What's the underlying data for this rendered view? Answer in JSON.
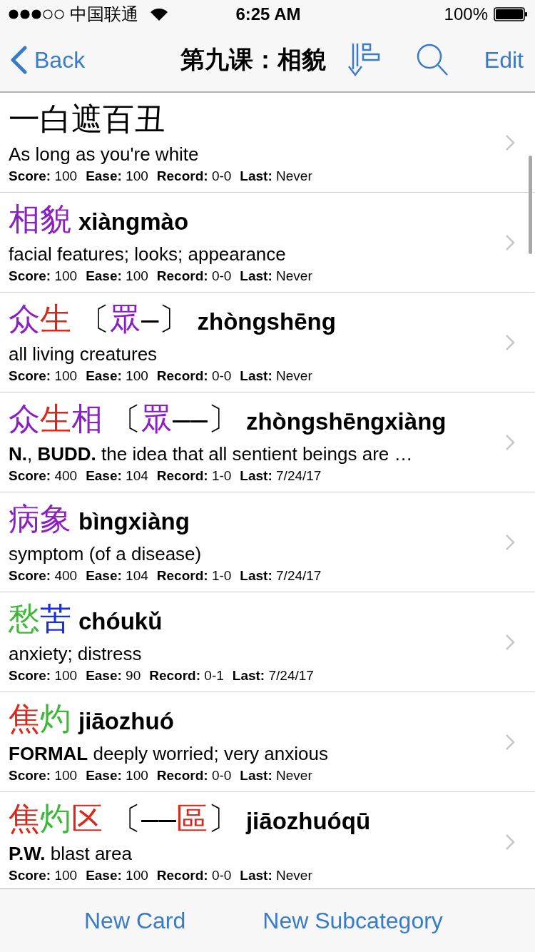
{
  "status_bar": {
    "carrier": "中国联通",
    "time": "6:25 AM",
    "battery": "100%"
  },
  "nav": {
    "back": "Back",
    "title": "第九课：相貌",
    "edit": "Edit"
  },
  "cards": [
    {
      "headword": [
        {
          "text": "一白遮百丑",
          "color": "#000000"
        }
      ],
      "definition": "As long as you're white",
      "stats": [
        {
          "label": "Score:",
          "value": "100"
        },
        {
          "label": "Ease:",
          "value": "100"
        },
        {
          "label": "Record:",
          "value": "0-0"
        },
        {
          "label": "Last:",
          "value": "Never"
        }
      ]
    },
    {
      "headword": [
        {
          "text": "相貌",
          "color": "#8a1fc4"
        }
      ],
      "pinyin": "xiàngmào",
      "definition": "facial features; looks; appearance",
      "stats": [
        {
          "label": "Score:",
          "value": "100"
        },
        {
          "label": "Ease:",
          "value": "100"
        },
        {
          "label": "Record:",
          "value": "0-0"
        },
        {
          "label": "Last:",
          "value": "Never"
        }
      ]
    },
    {
      "headword": [
        {
          "text": "众",
          "color": "#8a1fc4"
        },
        {
          "text": "生",
          "color": "#d8291c"
        }
      ],
      "traditional": [
        {
          "text": "〔",
          "color": "#000000"
        },
        {
          "text": "眾",
          "color": "#8a1fc4"
        },
        {
          "text": "–〕",
          "color": "#000000"
        }
      ],
      "pinyin": "zhòngshēng",
      "definition": "all living creatures",
      "stats": [
        {
          "label": "Score:",
          "value": "100"
        },
        {
          "label": "Ease:",
          "value": "100"
        },
        {
          "label": "Record:",
          "value": "0-0"
        },
        {
          "label": "Last:",
          "value": "Never"
        }
      ]
    },
    {
      "headword": [
        {
          "text": "众",
          "color": "#8a1fc4"
        },
        {
          "text": "生",
          "color": "#d8291c"
        },
        {
          "text": "相",
          "color": "#8a1fc4"
        }
      ],
      "traditional": [
        {
          "text": "〔",
          "color": "#000000"
        },
        {
          "text": "眾",
          "color": "#8a1fc4"
        },
        {
          "text": "––〕",
          "color": "#000000"
        }
      ],
      "pinyin": "zhòngshēngxiàng",
      "definition": "**N.**, **BUDD.** the idea that all sentient beings are …",
      "stats": [
        {
          "label": "Score:",
          "value": "400"
        },
        {
          "label": "Ease:",
          "value": "104"
        },
        {
          "label": "Record:",
          "value": "1-0"
        },
        {
          "label": "Last:",
          "value": "7/24/17"
        }
      ]
    },
    {
      "headword": [
        {
          "text": "病象",
          "color": "#8a1fc4"
        }
      ],
      "pinyin": "bìngxiàng",
      "definition": "symptom (of a disease)",
      "stats": [
        {
          "label": "Score:",
          "value": "400"
        },
        {
          "label": "Ease:",
          "value": "104"
        },
        {
          "label": "Record:",
          "value": "1-0"
        },
        {
          "label": "Last:",
          "value": "7/24/17"
        }
      ]
    },
    {
      "headword": [
        {
          "text": "愁",
          "color": "#3fb83a"
        },
        {
          "text": "苦",
          "color": "#1a2fe0"
        }
      ],
      "pinyin": "chóukǔ",
      "definition": "anxiety; distress",
      "stats": [
        {
          "label": "Score:",
          "value": "100"
        },
        {
          "label": "Ease:",
          "value": "90"
        },
        {
          "label": "Record:",
          "value": "0-1"
        },
        {
          "label": "Last:",
          "value": "7/24/17"
        }
      ]
    },
    {
      "headword": [
        {
          "text": "焦",
          "color": "#d8291c"
        },
        {
          "text": "灼",
          "color": "#3fb83a"
        }
      ],
      "pinyin": "jiāozhuó",
      "definition": "**FORMAL** deeply worried; very anxious",
      "stats": [
        {
          "label": "Score:",
          "value": "100"
        },
        {
          "label": "Ease:",
          "value": "100"
        },
        {
          "label": "Record:",
          "value": "0-0"
        },
        {
          "label": "Last:",
          "value": "Never"
        }
      ]
    },
    {
      "headword": [
        {
          "text": "焦",
          "color": "#d8291c"
        },
        {
          "text": "灼",
          "color": "#3fb83a"
        },
        {
          "text": "区",
          "color": "#d8291c"
        }
      ],
      "traditional": [
        {
          "text": "〔––",
          "color": "#000000"
        },
        {
          "text": "區",
          "color": "#d8291c"
        },
        {
          "text": "〕",
          "color": "#000000"
        }
      ],
      "pinyin": "jiāozhuóqū",
      "definition": "**P.W.** blast area",
      "stats": [
        {
          "label": "Score:",
          "value": "100"
        },
        {
          "label": "Ease:",
          "value": "100"
        },
        {
          "label": "Record:",
          "value": "0-0"
        },
        {
          "label": "Last:",
          "value": "Never"
        }
      ]
    }
  ],
  "toolbar": {
    "buttons": [
      "New Card",
      "New Subcategory"
    ]
  }
}
